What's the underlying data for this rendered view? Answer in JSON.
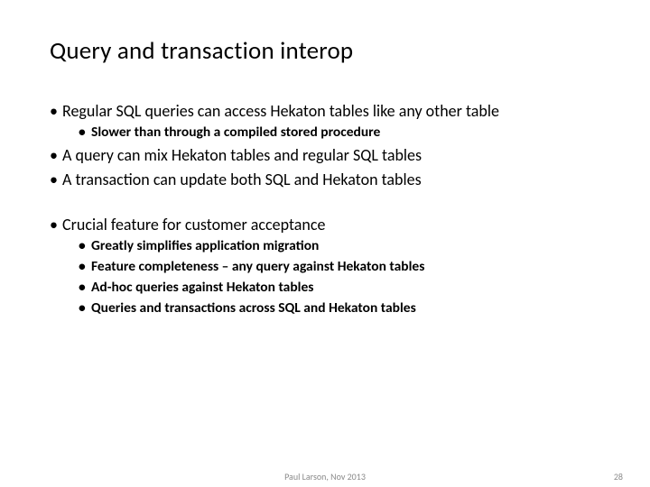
{
  "title": "Query and transaction interop",
  "bullets": {
    "b1": "Regular SQL queries can access Hekaton tables like any other table",
    "b1_sub1": "Slower than through a compiled stored procedure",
    "b2": "A query can mix Hekaton tables and regular SQL tables",
    "b3": "A transaction can update both SQL and Hekaton tables",
    "b4": "Crucial feature for customer acceptance",
    "b4_sub1": "Greatly simplifies application migration",
    "b4_sub2": "Feature completeness – any query against Hekaton tables",
    "b4_sub3": "Ad-hoc queries against Hekaton tables",
    "b4_sub4": "Queries and transactions across SQL and Hekaton tables"
  },
  "footer": {
    "center": "Paul Larson, Nov 2013",
    "page": "28"
  }
}
